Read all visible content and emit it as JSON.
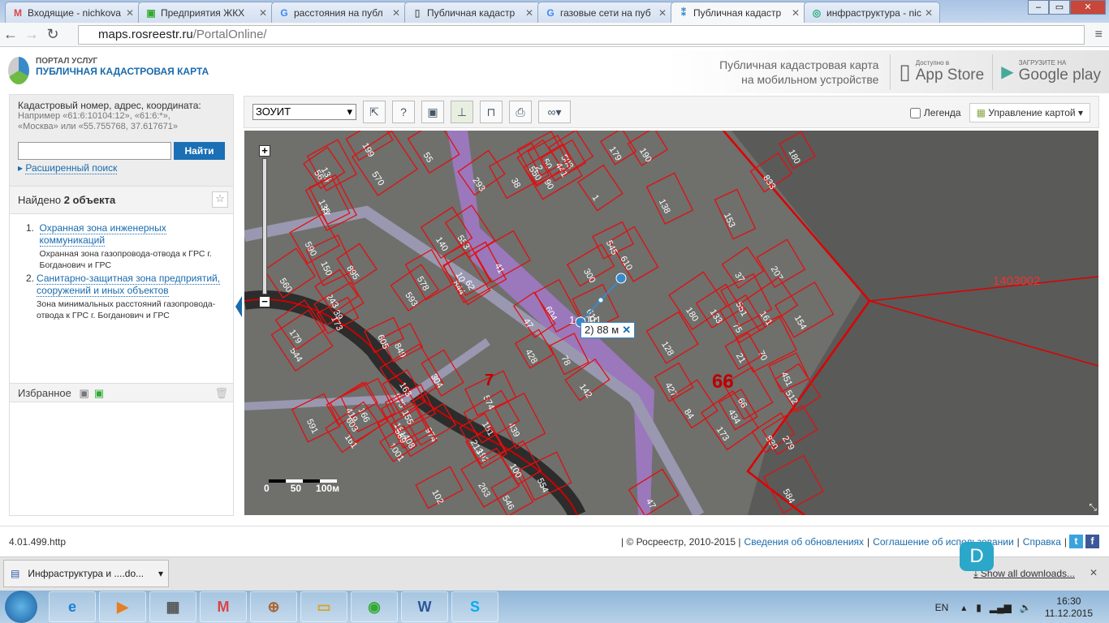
{
  "browser": {
    "tabs": [
      {
        "label": "Входящие - nichkova",
        "icon": "gmail-icon",
        "color": "#d44"
      },
      {
        "label": "Предприятия ЖКХ",
        "icon": "emblem-icon",
        "color": "#3a3"
      },
      {
        "label": "расстояния на публ",
        "icon": "google-icon",
        "color": "#4285f4"
      },
      {
        "label": "Публичная кадастр",
        "icon": "page-icon",
        "color": "#666"
      },
      {
        "label": "газовые сети на пуб",
        "icon": "google-icon",
        "color": "#4285f4"
      },
      {
        "label": "Публичная кадастр",
        "icon": "map-icon",
        "color": "#3a8ac9",
        "active": true
      },
      {
        "label": "инфраструктура - nic",
        "icon": "site-icon",
        "color": "#2a7"
      }
    ],
    "url_host": "maps.rosreestr.ru",
    "url_path": "/PortalOnline/"
  },
  "header": {
    "logo_line1": "ПОРТАЛ УСЛУГ",
    "logo_line2": "ПУБЛИЧНАЯ КАДАСТРОВАЯ КАРТА",
    "promo_line1": "Публичная кадастровая карта",
    "promo_line2": "на мобильном устройстве",
    "appstore_small": "Доступно в",
    "appstore": "App Store",
    "gplay_small": "ЗАГРУЗИТЕ НА",
    "gplay": "Google play"
  },
  "search": {
    "label": "Кадастровый номер, адрес, координата:",
    "example_line1": "Например «61:6:10104:12», «61:6:*»,",
    "example_line2": "«Москва» или «55.755768, 37.617671»",
    "value": "",
    "button": "Найти",
    "advanced": "Расширенный поиск"
  },
  "results": {
    "found_prefix": "Найдено ",
    "found_count": "2 объекта",
    "items": [
      {
        "num": "1.",
        "title": "Охранная зона инженерных коммуникаций",
        "desc": "Охранная зона газопровода-отвода к ГРС г. Богданович и ГРС"
      },
      {
        "num": "2.",
        "title": "Санитарно-защитная зона предприятий, сооружений и иных объектов",
        "desc": "Зона минимальных расстояний газопровода-отвода к ГРС г. Богданович и ГРС"
      }
    ]
  },
  "favorites": {
    "label": "Избранное"
  },
  "toolbar": {
    "layer_select": "ЗОУИТ",
    "legend": "Легенда",
    "legend_checked": false,
    "map_control": "Управление картой"
  },
  "map": {
    "measure": "2) 88 м",
    "quarter_label": "1403002",
    "big_label": "66",
    "label_7": "7",
    "label_partial": "1  1001",
    "scale": [
      "0",
      "50",
      "100м"
    ],
    "parcels": [
      "428",
      "90",
      "974",
      "975",
      "570",
      "546",
      "610",
      "849",
      "844",
      "75",
      "427",
      "131",
      "207",
      "133",
      "138",
      "584",
      "583",
      "574",
      "560",
      "154",
      "161",
      "166",
      "1001",
      "544",
      "550",
      "553",
      "199",
      "173",
      "439",
      "545",
      "567",
      "611",
      "604",
      "554",
      "551",
      "70",
      "38",
      "151",
      "434",
      "512",
      "605",
      "50",
      "181",
      "192",
      "21",
      "593",
      "591",
      "243",
      "419",
      "578",
      "163",
      "830",
      "603",
      "10",
      "84",
      "47",
      "78",
      "128",
      "77",
      "161",
      "37",
      "62",
      "441",
      "140",
      "142",
      "47",
      "150",
      "153",
      "173",
      "304",
      "102",
      "190",
      "590",
      "833",
      "895",
      "41",
      "66",
      "408",
      "100",
      "589",
      "39",
      "55",
      "179",
      "180",
      "279",
      "263",
      "213",
      "300",
      "293",
      "451",
      "155",
      "135",
      "179",
      "180",
      "1",
      "2"
    ]
  },
  "footer": {
    "version": "4.01.499.http",
    "copyright": "| © Росреестр, 2010-2015 |",
    "links": [
      "Сведения об обновлениях",
      "Соглашение об использовании",
      "Справка"
    ]
  },
  "downloads": {
    "item": "Инфраструктура и ....do...",
    "show_all": "Show all downloads...",
    "badge": "D"
  },
  "taskbar": {
    "apps": [
      "ie",
      "media",
      "calc",
      "gmail",
      "app",
      "explorer",
      "chrome",
      "word",
      "skype"
    ],
    "lang": "EN",
    "time": "16:30",
    "date": "11.12.2015"
  }
}
